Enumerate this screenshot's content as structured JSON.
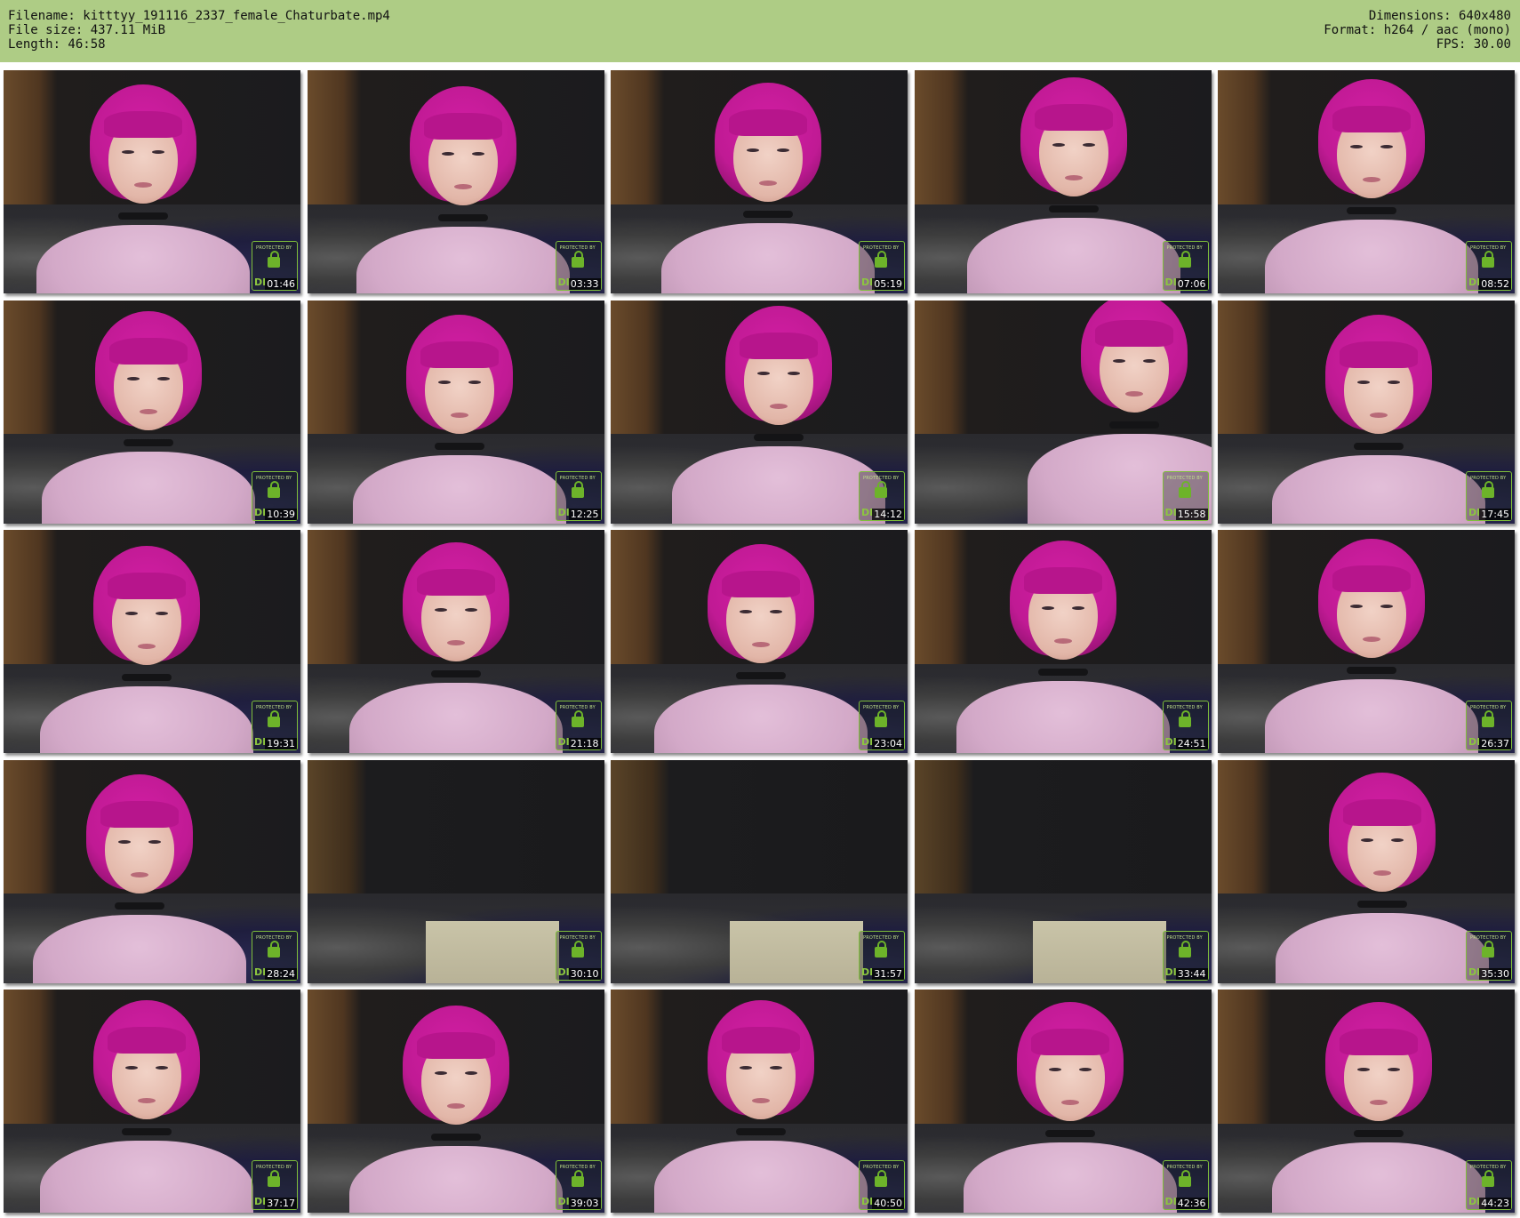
{
  "header": {
    "filename": "Filename: kitttyy_191116_2337_female_Chaturbate.mp4",
    "filesize": "File size: 437.11 MiB",
    "length": "Length: 46:58",
    "dimensions": "Dimensions: 640x480",
    "format": "Format: h264 / aac (mono)",
    "fps": "FPS: 30.00"
  },
  "colors": {
    "header_bg": "#aecc85",
    "hair": "#c01a94",
    "shirt": "#dcb3d2",
    "watermark": "#8cc63f"
  },
  "watermark": {
    "top_text": "PROTECTED BY",
    "bottom_text": "DI"
  },
  "thumbnails": [
    {
      "time": "01:46"
    },
    {
      "time": "03:33"
    },
    {
      "time": "05:19"
    },
    {
      "time": "07:06"
    },
    {
      "time": "08:52"
    },
    {
      "time": "10:39"
    },
    {
      "time": "12:25"
    },
    {
      "time": "14:12"
    },
    {
      "time": "15:58"
    },
    {
      "time": "17:45"
    },
    {
      "time": "19:31"
    },
    {
      "time": "21:18"
    },
    {
      "time": "23:04"
    },
    {
      "time": "24:51"
    },
    {
      "time": "26:37"
    },
    {
      "time": "28:24"
    },
    {
      "time": "30:10"
    },
    {
      "time": "31:57"
    },
    {
      "time": "33:44"
    },
    {
      "time": "35:30"
    },
    {
      "time": "37:17"
    },
    {
      "time": "39:03"
    },
    {
      "time": "40:50"
    },
    {
      "time": "42:36"
    },
    {
      "time": "44:23"
    }
  ]
}
